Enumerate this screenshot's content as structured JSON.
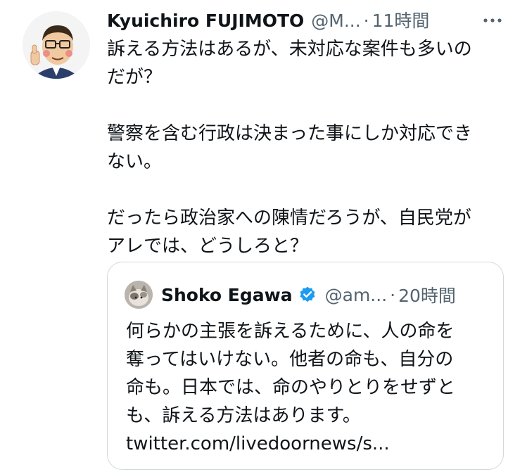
{
  "tweet": {
    "author_name": "Kyuichiro FUJIMOTO",
    "author_handle": "@M...",
    "separator": "·",
    "time": "11時間",
    "avatar_caption": "by 似顔絵イラスト",
    "text_lines": [
      "訴える方法はあるが、未対応な案件も多いの",
      "だが？",
      "",
      "警察を含む行政は決まった事にしか対応でき",
      "ない。",
      "",
      "だったら政治家への陳情だろうが、自民党が",
      "アレでは、どうしろと？"
    ]
  },
  "quote": {
    "author_name": "Shoko Egawa",
    "author_handle": "@am...",
    "separator": "·",
    "time": "20時間",
    "text_lines": [
      "何らかの主張を訴えるために、人の命を",
      "奪ってはいけない。他者の命も、自分の",
      "命も。日本では、命のやりとりをせずと",
      "も、訴える方法はあります。",
      "twitter.com/livedoornews/s..."
    ]
  },
  "icons": {
    "more": "more-icon",
    "verified": "verified-icon"
  },
  "colors": {
    "text": "#0f1419",
    "secondary": "#536471",
    "border": "#cfd9de",
    "verified": "#1d9bf0"
  }
}
